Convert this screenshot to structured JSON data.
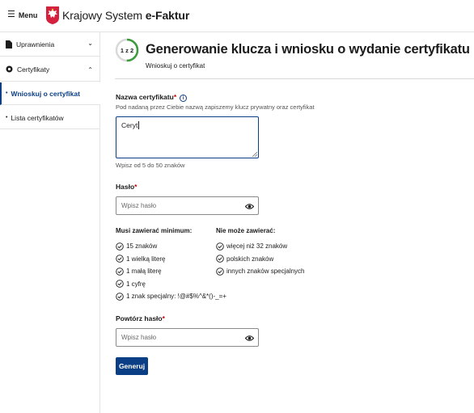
{
  "header": {
    "menu_label": "Menu",
    "brand_prefix": "Krajowy System ",
    "brand_strong": "e-Faktur"
  },
  "sidebar": {
    "items": [
      {
        "label": "Uprawnienia"
      },
      {
        "label": "Certyfikaty"
      },
      {
        "label": "Wnioskuj o certyfikat"
      },
      {
        "label": "Lista certyfikatów"
      }
    ]
  },
  "main": {
    "step": "1 z 2",
    "step_progress": 0.5,
    "title": "Generowanie klucza i wniosku o wydanie certyfikatu",
    "subtitle": "Wnioskuj o certyfikat",
    "cert_name": {
      "label": "Nazwa certyfikatu",
      "required_mark": "*",
      "info_icon": "i",
      "hint": "Pod nadaną przez Ciebie nazwą zapiszemy klucz prywatny oraz certyfikat",
      "value": "Ceryt",
      "helper": "Wpisz od 5 do 50 znaków"
    },
    "password": {
      "label": "Hasło",
      "required_mark": "*",
      "placeholder": "Wpisz hasło"
    },
    "must_contain": {
      "heading": "Musi zawierać minimum:",
      "items": [
        "15 znaków",
        "1 wielką literę",
        "1 małą literę",
        "1 cyfrę",
        "1 znak specjalny: !@#$%^&*()-_=+"
      ]
    },
    "must_not_contain": {
      "heading": "Nie może zawierać:",
      "items": [
        "więcej niż 32 znaków",
        "polskich znaków",
        "innych znaków specjalnych"
      ]
    },
    "repeat_password": {
      "label": "Powtórz hasło",
      "required_mark": "*",
      "placeholder": "Wpisz hasło"
    },
    "generate_label": "Generuj"
  },
  "colors": {
    "accent": "#0b3f85",
    "required": "#cc0000",
    "step_ring": "#3c9b3c"
  }
}
